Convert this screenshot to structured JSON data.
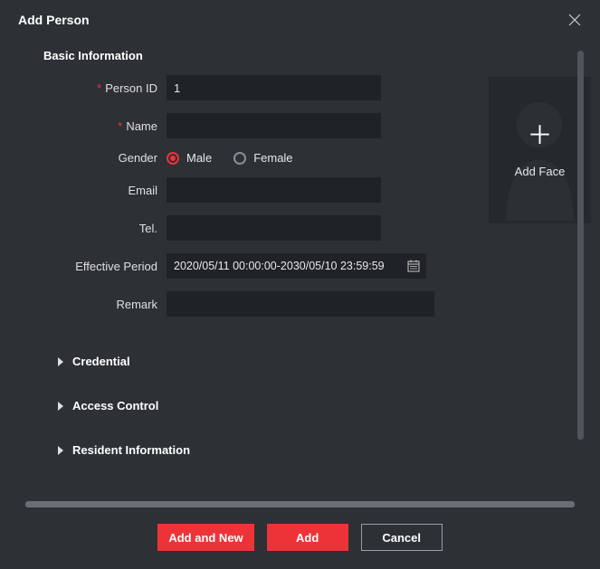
{
  "dialog": {
    "title": "Add Person"
  },
  "section_basic": "Basic Information",
  "fields": {
    "person_id": {
      "label": "Person ID",
      "value": "1"
    },
    "name": {
      "label": "Name",
      "value": ""
    },
    "gender": {
      "label": "Gender",
      "male": "Male",
      "female": "Female",
      "selected": "male"
    },
    "email": {
      "label": "Email",
      "value": ""
    },
    "tel": {
      "label": "Tel.",
      "value": ""
    },
    "period": {
      "label": "Effective Period",
      "value": "2020/05/11 00:00:00-2030/05/10 23:59:59"
    },
    "remark": {
      "label": "Remark",
      "value": ""
    }
  },
  "face": {
    "label": "Add Face"
  },
  "sections": {
    "credential": "Credential",
    "access_control": "Access Control",
    "resident": "Resident Information"
  },
  "buttons": {
    "add_new": "Add and New",
    "add": "Add",
    "cancel": "Cancel"
  },
  "colors": {
    "accent": "#ee3338",
    "bg": "#2d3035",
    "input_bg": "#1f2226"
  }
}
